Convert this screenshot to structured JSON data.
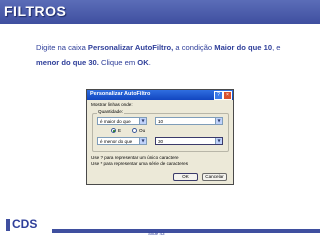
{
  "slide": {
    "title": "FILTROS",
    "slide_number": "Slide 43"
  },
  "instruction": {
    "p1": "Digite na caixa ",
    "b1": "Personalizar AutoFiltro,",
    "p2": " a condição ",
    "b2": "Maior do que 10",
    "p3": ", e",
    "b3": "menor do que 30.",
    "p4": " Clique em ",
    "b4": "OK",
    "p5": "."
  },
  "dialog": {
    "title": "Personalizar AutoFiltro",
    "help_glyph": "?",
    "close_glyph": "×",
    "show_rows_label": "Mostrar linhas onde:",
    "group_label": "Quantidade:",
    "cond1_operator": "é maior do que",
    "cond1_value": "10",
    "radio_and": "E",
    "radio_or": "Ou",
    "cond2_operator": "é menor do que",
    "cond2_value": "30",
    "hint1": "Use ? para representar um único caractere",
    "hint2": "Use * para representar uma série de caracteres",
    "ok_label": "OK",
    "cancel_label": "Cancelar",
    "selected_logic": "E"
  },
  "logo": {
    "text": "CDS",
    "subtitle": ""
  },
  "colors": {
    "brand_blue": "#3f4f9f",
    "text_blue": "#2f3f9a",
    "dialog_bg": "#ece9d8",
    "titlebar_blue": "#1246c0"
  }
}
